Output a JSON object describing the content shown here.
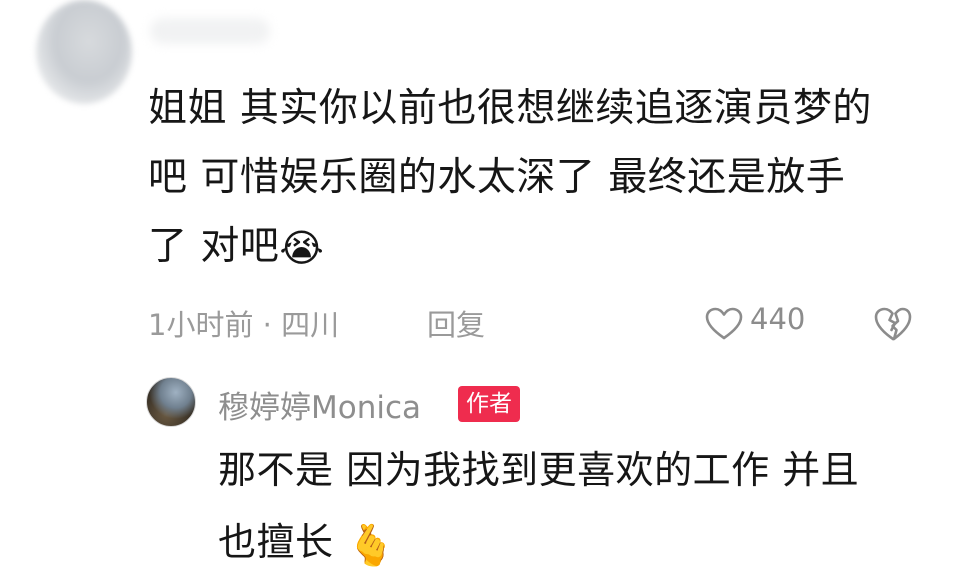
{
  "comment": {
    "lines": [
      "姐姐 其实你以前也很想继续追逐演员梦的",
      "吧 可惜娱乐圈的水太深了 最终还是放手",
      "了 对吧"
    ],
    "emoji": "😭",
    "time_location": "1小时前 · 四川",
    "reply_label": "回复",
    "like_count": "440"
  },
  "reply": {
    "author_name": "穆婷婷Monica",
    "author_badge": "作者",
    "lines": [
      "那不是 因为我找到更喜欢的工作 并且",
      "也擅长"
    ],
    "emoji": "🫰"
  },
  "colors": {
    "text": "#161616",
    "meta": "#9a9a9a",
    "badge": "#ef2c4e"
  },
  "icons": {
    "like": "heart-outline-icon",
    "dislike": "broken-heart-icon"
  }
}
